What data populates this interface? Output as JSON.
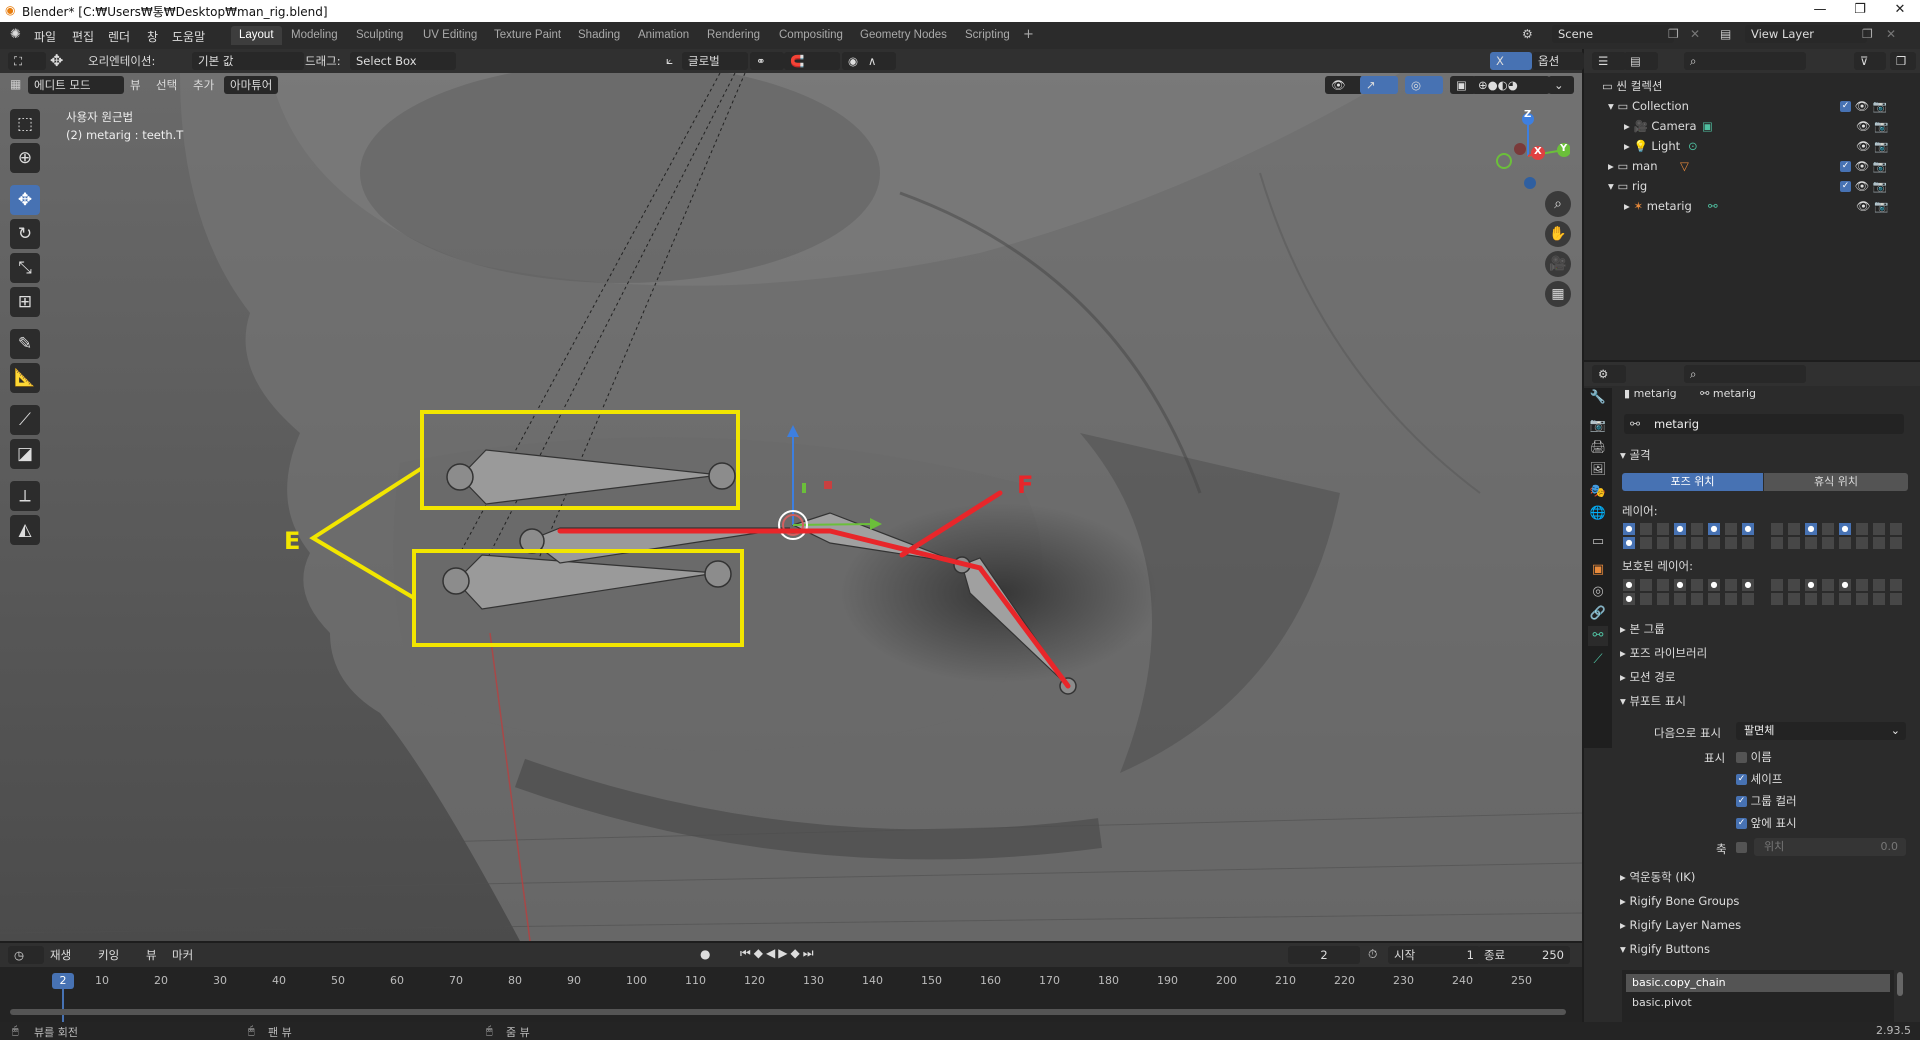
{
  "window": {
    "title": "Blender* [C:₩Users₩통₩Desktop₩man_rig.blend]"
  },
  "menu": [
    "파일",
    "편집",
    "렌더",
    "창",
    "도움말"
  ],
  "workspaces": [
    "Layout",
    "Modeling",
    "Sculpting",
    "UV Editing",
    "Texture Paint",
    "Shading",
    "Animation",
    "Rendering",
    "Compositing",
    "Geometry Nodes",
    "Scripting"
  ],
  "active_workspace": "Layout",
  "scene": {
    "name": "Scene",
    "view_layer": "View Layer"
  },
  "viewport_header": {
    "orientation_label": "오리엔테이션:",
    "orientation_value": "기본 값",
    "drag_label": "드래그:",
    "drag_value": "Select Box",
    "transform_orientation": "글로벌",
    "options": "옵션"
  },
  "viewport_header2": {
    "mode": "에디트 모드",
    "view": "뷰",
    "select": "선택",
    "add": "추가",
    "armature": "아마튜어"
  },
  "viewport_overlay": {
    "line1": "사용자 원근법",
    "line2": "(2) metarig : teeth.T"
  },
  "annotations": {
    "e": "E",
    "f": "F"
  },
  "gizmo": {
    "x": "X",
    "y": "Y",
    "z": "Z"
  },
  "outliner": {
    "root": "씬 컬렉션",
    "items": [
      {
        "label": "Collection",
        "indent": 1
      },
      {
        "label": "Camera",
        "indent": 2
      },
      {
        "label": "Light",
        "indent": 2
      },
      {
        "label": "man",
        "indent": 1
      },
      {
        "label": "rig",
        "indent": 1
      },
      {
        "label": "metarig",
        "indent": 2
      }
    ]
  },
  "properties": {
    "breadcrumb1": "metarig",
    "breadcrumb2": "metarig",
    "data_name": "metarig",
    "skeleton": "골격",
    "pose_position": "포즈 위치",
    "rest_position": "휴식 위치",
    "layers": "레이어:",
    "protected_layers": "보호된 레이어:",
    "bone_groups": "본 그룹",
    "pose_library": "포즈 라이브러리",
    "motion_paths": "모션 경로",
    "viewport_display": "뷰포트 표시",
    "display_as_label": "다음으로 표시",
    "display_as_value": "팔면체",
    "show_label": "표시",
    "names": "이름",
    "shapes": "셰이프",
    "group_colors": "그룹 컬러",
    "in_front": "앞에 표시",
    "axes_label": "축",
    "axes_position": "위치",
    "axes_value": "0.0",
    "ik": "역운동학 (IK)",
    "rigify_bone_groups": "Rigify Bone Groups",
    "rigify_layer_names": "Rigify Layer Names",
    "rigify_buttons": "Rigify Buttons",
    "list_item1": "basic.copy_chain",
    "list_item2": "basic.pivot"
  },
  "timeline": {
    "playback": "재생",
    "keying": "키잉",
    "view": "뷰",
    "marker": "마커",
    "current_frame": "2",
    "start_label": "시작",
    "start": "1",
    "end_label": "종료",
    "end": "250",
    "ticks": [
      "10",
      "20",
      "30",
      "40",
      "50",
      "60",
      "70",
      "80",
      "90",
      "100",
      "110",
      "120",
      "130",
      "140",
      "150",
      "160",
      "170",
      "180",
      "190",
      "200",
      "210",
      "220",
      "230",
      "240",
      "250"
    ]
  },
  "status": {
    "rotate": "뷰를 회전",
    "pan": "팬 뷰",
    "zoom": "줌 뷰",
    "version": "2.93.5"
  },
  "colors": {
    "accent": "#4772b3",
    "annotation_yellow": "#f2e600",
    "annotation_red": "#e8262a"
  }
}
